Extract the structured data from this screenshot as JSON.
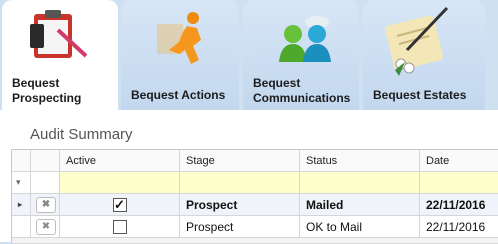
{
  "tabs": [
    {
      "label": "Bequest Prospecting",
      "icon": "clipboard-icon",
      "active": true
    },
    {
      "label": "Bequest Actions",
      "icon": "runner-icon",
      "active": false
    },
    {
      "label": "Bequest Communications",
      "icon": "people-icon",
      "active": false
    },
    {
      "label": "Bequest Estates",
      "icon": "scroll-icon",
      "active": false
    }
  ],
  "panel": {
    "title": "Audit Summary"
  },
  "grid": {
    "columns": [
      "Active",
      "Stage",
      "Status",
      "Date"
    ],
    "filter_icon": "▾",
    "rows": [
      {
        "active": true,
        "stage": "Prospect",
        "status": "Mailed",
        "date": "22/11/2016"
      },
      {
        "active": false,
        "stage": "Prospect",
        "status": "OK to Mail",
        "date": "22/11/2016"
      }
    ]
  },
  "colors": {
    "background": "#cfe0f1",
    "active_tab": "#ffffff",
    "filter_row": "#ffffcc"
  }
}
